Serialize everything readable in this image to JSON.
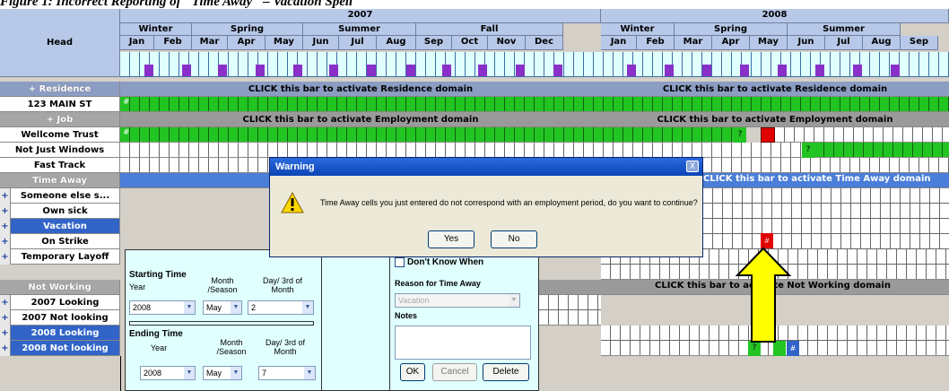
{
  "caption": "Figure 1: Incorrect Reporting of \"Time Away\" – Vacation Spell",
  "header": {
    "head_label": "Head",
    "years": [
      "2007",
      "2008"
    ],
    "seasons_2007": [
      "Winter",
      "Spring",
      "Summer",
      "Fall"
    ],
    "seasons_2008": [
      "Winter",
      "Spring",
      "Summer"
    ],
    "months_2007": [
      "Jan",
      "Feb",
      "Mar",
      "Apr",
      "May",
      "Jun",
      "Jul",
      "Aug",
      "Sep",
      "Oct",
      "Nov",
      "Dec"
    ],
    "months_2008": [
      "Jan",
      "Feb",
      "Mar",
      "Apr",
      "May",
      "Jun",
      "Jul",
      "Aug",
      "Sep"
    ]
  },
  "rows": {
    "residence": "+ Residence",
    "residence_bar": "CLICK this bar to activate Residence domain",
    "address": "123 MAIN ST",
    "job": "+ Job",
    "job_bar": "CLICK this bar to activate Employment domain",
    "wellcome": "Wellcome Trust",
    "not_just_windows": "Not Just Windows",
    "fast_track": "Fast Track",
    "time_away": "Time Away",
    "time_away_bar": "CLICK this bar to activate Time Away domain",
    "someone_else": "Someone else s...",
    "own_sick": "Own sick",
    "vacation": "Vacation",
    "on_strike": "On Strike",
    "temp_layoff": "Temporary Layoff",
    "not_working": "Not Working",
    "not_working_bar": "CLICK this bar to activate Not Working domain",
    "looking_2007": "2007 Looking",
    "not_looking_2007": "2007 Not looking",
    "looking_2008": "2008 Looking",
    "not_looking_2008": "2008 Not looking"
  },
  "markers": {
    "hash": "#",
    "question": "?",
    "plus": "+"
  },
  "dialog": {
    "title": "Warning",
    "message": "Time Away cells you just entered do not correspond with an employment period, do you want to continue?",
    "yes": "Yes",
    "no": "No",
    "close": "X"
  },
  "panel": {
    "starting_time": "Starting Time",
    "ending_time": "Ending Time",
    "year_label": "Year",
    "month_label": "Month /Season",
    "day_label": "Day/ 3rd of Month",
    "start_year": "2008",
    "start_month": "May",
    "start_day": "2",
    "end_year": "2008",
    "end_month": "May",
    "end_day": "7",
    "dont_know": "Don't Know When",
    "reason_label": "Reason for Time Away",
    "reason_value": "Vacation",
    "notes_label": "Notes",
    "ok": "OK",
    "cancel": "Cancel",
    "delete": "Delete"
  },
  "colors": {
    "header_bg": "#b7c8e8",
    "cell_bg": "#e0ffff",
    "green": "#22c422",
    "red": "#e00000",
    "purple": "#8a2fc8",
    "blue": "#3264c8",
    "arrow": "#ffff00"
  }
}
